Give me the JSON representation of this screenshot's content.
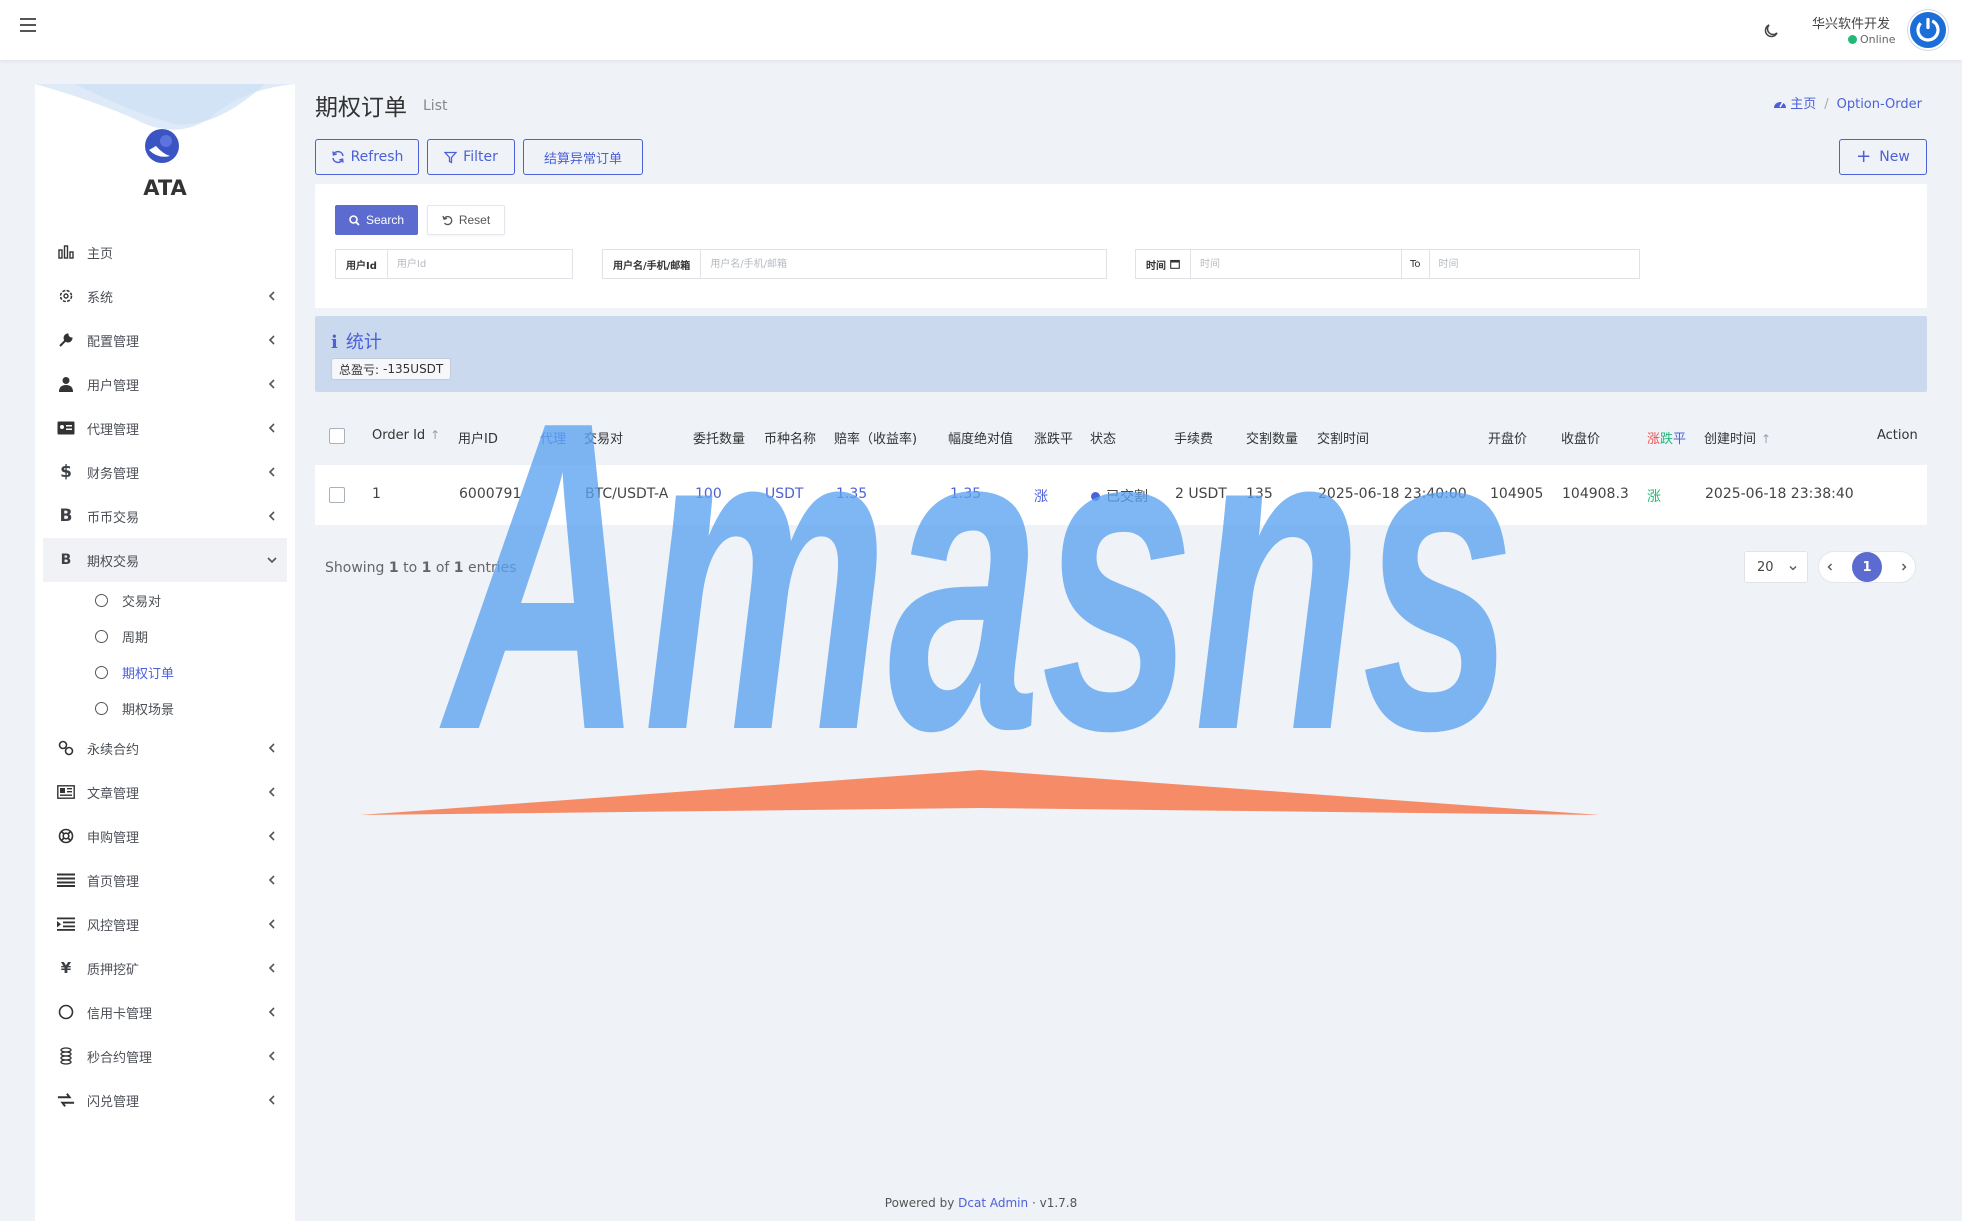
{
  "header": {
    "user_name": "华兴软件开发",
    "user_status": "Online"
  },
  "sidebar": {
    "brand": "ATA",
    "items": [
      {
        "label": "主页",
        "icon": "bar-chart-icon"
      },
      {
        "label": "系统",
        "icon": "gear-icon"
      },
      {
        "label": "配置管理",
        "icon": "wrench-icon"
      },
      {
        "label": "用户管理",
        "icon": "user-icon"
      },
      {
        "label": "代理管理",
        "icon": "id-card-icon"
      },
      {
        "label": "财务管理",
        "icon": "dollar-icon"
      },
      {
        "label": "币币交易",
        "icon": "bitcoin-icon"
      },
      {
        "label": "期权交易",
        "icon": "bitcoin-icon"
      },
      {
        "label": "永续合约",
        "icon": "link-icon"
      },
      {
        "label": "文章管理",
        "icon": "newspaper-icon"
      },
      {
        "label": "申购管理",
        "icon": "lifebuoy-icon"
      },
      {
        "label": "首页管理",
        "icon": "list-icon"
      },
      {
        "label": "风控管理",
        "icon": "indent-icon"
      },
      {
        "label": "质押挖矿",
        "icon": "yen-icon"
      },
      {
        "label": "信用卡管理",
        "icon": "circle-icon"
      },
      {
        "label": "秒合约管理",
        "icon": "coins-icon"
      },
      {
        "label": "闪兑管理",
        "icon": "exchange-icon"
      }
    ],
    "subitems": [
      {
        "label": "交易对"
      },
      {
        "label": "周期"
      },
      {
        "label": "期权订单"
      },
      {
        "label": "期权场景"
      }
    ]
  },
  "page": {
    "title": "期权订单",
    "subtitle": "List",
    "breadcrumb_home": "主页",
    "breadcrumb_current": "Option-Order"
  },
  "toolbar": {
    "refresh": "Refresh",
    "filter": "Filter",
    "settle_abnormal": "结算异常订单",
    "new": "New"
  },
  "filter": {
    "search": "Search",
    "reset": "Reset",
    "user_id_label": "用户Id",
    "user_id_placeholder": "用户Id",
    "user_label": "用户名/手机/邮箱",
    "user_placeholder": "用户名/手机/邮箱",
    "time_label": "时间",
    "time_placeholder": "时间",
    "to_label": "To"
  },
  "stats": {
    "title": "统计",
    "total_label": "总盈亏:",
    "total_value": "-135USDT"
  },
  "table": {
    "columns": [
      "Order Id",
      "用户ID",
      "代理",
      "交易对",
      "委托数量",
      "币种名称",
      "赔率（收益率)",
      "幅度绝对值",
      "涨跌平",
      "状态",
      "手续费",
      "交割数量",
      "交割时间",
      "开盘价",
      "收盘价",
      "涨跌平",
      "创建时间",
      "Action"
    ],
    "rows": [
      {
        "order_id": "1",
        "user_id": "6000791",
        "agent": "",
        "pair": "BTC/USDT-A",
        "quantity": "100",
        "currency": "USDT",
        "odds": "1.35",
        "amplitude": "1.35",
        "direction": "涨",
        "status": "已交割",
        "fee": "2 USDT",
        "delivery_qty": "135",
        "delivery_time": "2025-06-18 23:40:00",
        "open_price": "104905",
        "close_price": "104908.3",
        "result": "涨",
        "created_at": "2025-06-18 23:38:40"
      }
    ]
  },
  "pagination": {
    "showing_prefix": "Showing",
    "from": "1",
    "to_word": "to",
    "to": "1",
    "of_word": "of",
    "total": "1",
    "entries_word": "entries",
    "per_page": "20",
    "current_page": "1"
  },
  "footer": {
    "powered_by": "Powered by",
    "product": "Dcat Admin",
    "version": "v1.7.8"
  },
  "watermark": {
    "text": "Amasns"
  },
  "colors": {
    "accent": "#4c60da",
    "up": "#21b978",
    "down": "#ea5455",
    "watermark_blue": "#5aa3f0",
    "watermark_orange": "#f5865f"
  }
}
